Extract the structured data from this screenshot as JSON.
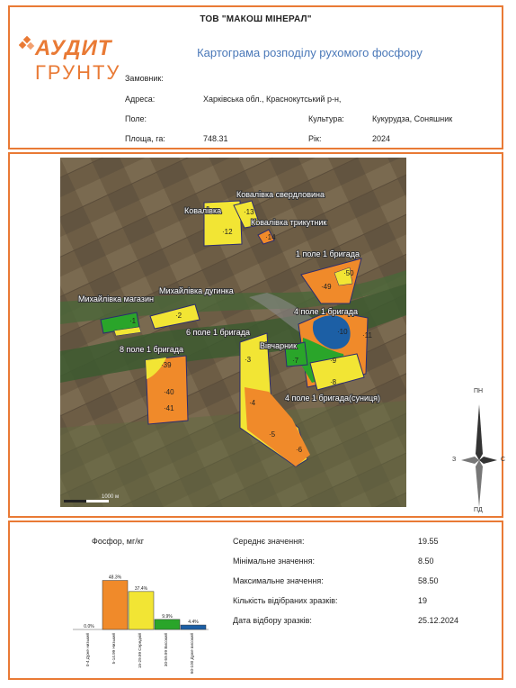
{
  "header": {
    "org": "ТОВ \"МАКОШ МІНЕРАЛ\"",
    "map_title": "Картограма розподілу рухомого фосфору",
    "logo_line1": "АУДИТ",
    "logo_line2": "ГРУНТУ",
    "customer_label": "Замовник:",
    "customer_value": "",
    "address_label": "Адреса:",
    "address_value": "Харківська обл., Краснокутський р-н,",
    "field_label": "Поле:",
    "field_value": "",
    "culture_label": "Культура:",
    "culture_value": "Кукурудза, Соняшник",
    "area_label": "Площа, га:",
    "area_value": "748.31",
    "year_label": "Рік:",
    "year_value": "2024"
  },
  "map": {
    "field_names": [
      "Ковалівка",
      "Ковалівка свердловина",
      "Ковалівка трикутник",
      "1 поле 1 бригада",
      "Михайлівка дугинка",
      "Михайлівка магазин",
      "4 поле 1 бригада",
      "6 поле 1 бригада",
      "Вівчарник",
      "8 поле 1 бригада",
      "4 поле 1 бригада(суниця)"
    ],
    "points": [
      "1",
      "2",
      "3",
      "4",
      "5",
      "6",
      "7",
      "8",
      "9",
      "10",
      "11",
      "12",
      "13",
      "14",
      "39",
      "40",
      "41",
      "49",
      "50"
    ],
    "scale_label": "1000 м",
    "compass": {
      "north": "ПН",
      "south": "ПД",
      "west": "З",
      "east": "С"
    },
    "colors": {
      "very_low": "#b30000",
      "low": "#f08a2a",
      "medium": "#f2e534",
      "high": "#2aa52a",
      "very_high": "#1c5fa5"
    }
  },
  "chart_data": {
    "type": "bar",
    "title": "Фосфор, мг/кг",
    "categories": [
      "0-4 Дуже низький",
      "5-14.99 Низький",
      "15-29.99 Середній",
      "30-59.99 Високий",
      "60-100 Дуже високий"
    ],
    "values": [
      0.0,
      48.3,
      37.4,
      9.9,
      4.4
    ],
    "value_labels": [
      "0.0%",
      "48.3%",
      "37.4%",
      "9.9%",
      "4.4%"
    ],
    "colors": [
      "#b30000",
      "#f08a2a",
      "#f2e534",
      "#2aa52a",
      "#1c5fa5"
    ],
    "ylim": [
      0,
      55
    ]
  },
  "stats": [
    {
      "label": "Середнє значення:",
      "value": "19.55"
    },
    {
      "label": "Мінімальне значення:",
      "value": "8.50"
    },
    {
      "label": "Максимальне значення:",
      "value": "58.50"
    },
    {
      "label": "Кількість відібраних зразків:",
      "value": "19"
    },
    {
      "label": "Дата відбору зразків:",
      "value": "25.12.2024"
    }
  ]
}
